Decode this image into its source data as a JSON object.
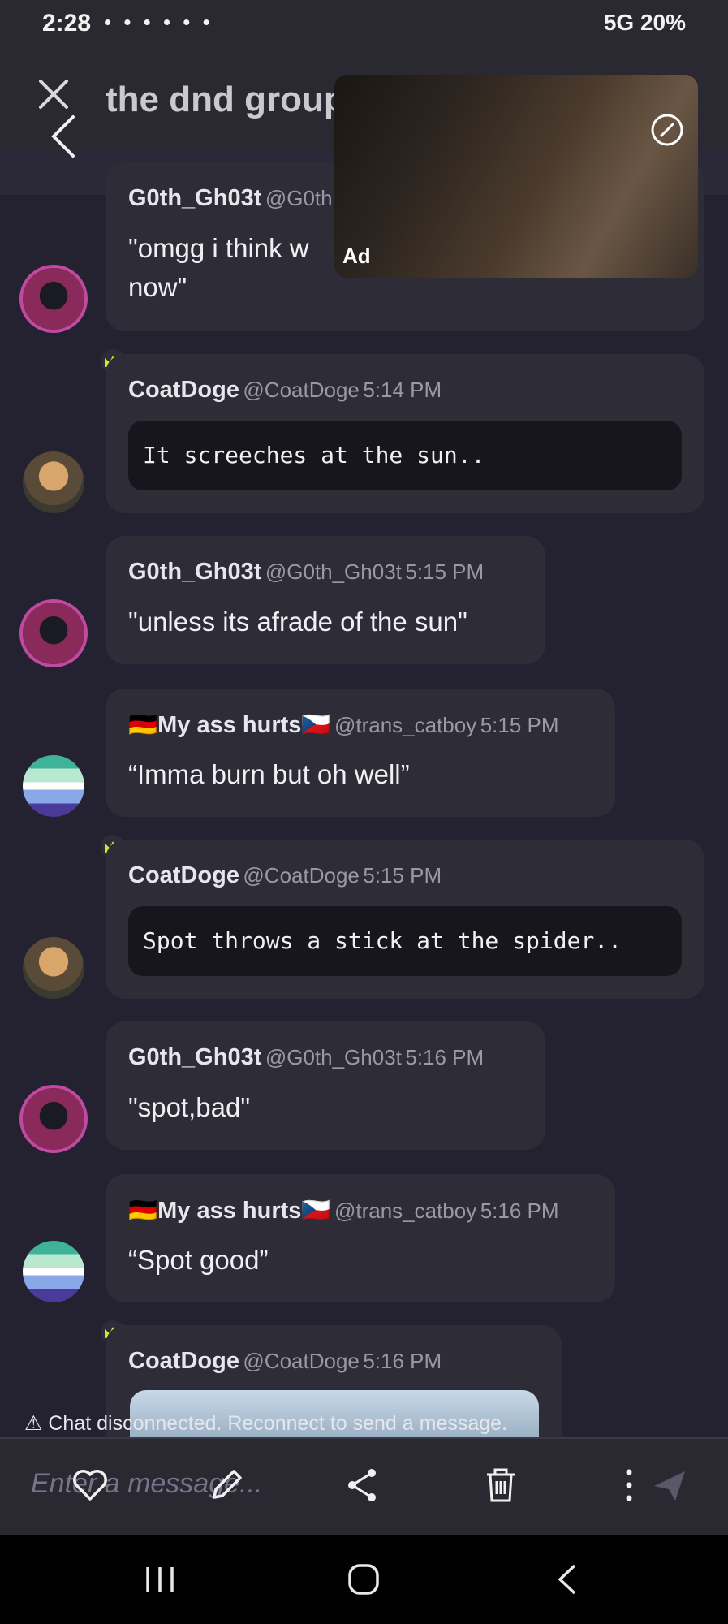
{
  "status_bar": {
    "time": "2:28",
    "notifications": "• • • • • •",
    "right": "5G 20%"
  },
  "header": {
    "title": "the dnd group"
  },
  "ad": {
    "label": "Ad"
  },
  "messages": [
    {
      "name": "G0th_Gh03t",
      "handle": "@G0th",
      "time": "",
      "text_line1": "\"omgg i think w",
      "text_line2": "now\""
    },
    {
      "name": "CoatDoge",
      "handle": "@CoatDoge",
      "time": "5:14 PM",
      "code": "It screeches at the sun.."
    },
    {
      "name": "G0th_Gh03t",
      "handle": "@G0th_Gh03t",
      "time": "5:15 PM",
      "text": "\"unless its afrade of the sun\""
    },
    {
      "name": "🇩🇪My ass hurts🇨🇿",
      "handle": "@trans_catboy",
      "time": "5:15 PM",
      "text": "“Imma burn but oh well”"
    },
    {
      "name": "CoatDoge",
      "handle": "@CoatDoge",
      "time": "5:15 PM",
      "code": "Spot throws a stick at the spider.."
    },
    {
      "name": "G0th_Gh03t",
      "handle": "@G0th_Gh03t",
      "time": "5:16 PM",
      "text": "\"spot,bad\""
    },
    {
      "name": "🇩🇪My ass hurts🇨🇿",
      "handle": "@trans_catboy",
      "time": "5:16 PM",
      "text": "“Spot good”"
    },
    {
      "name": "CoatDoge",
      "handle": "@CoatDoge",
      "time": "5:16 PM"
    }
  ],
  "chat_status": {
    "text": "Chat disconnected. Reconnect to send a message."
  },
  "composer": {
    "placeholder": "Enter a message..."
  }
}
